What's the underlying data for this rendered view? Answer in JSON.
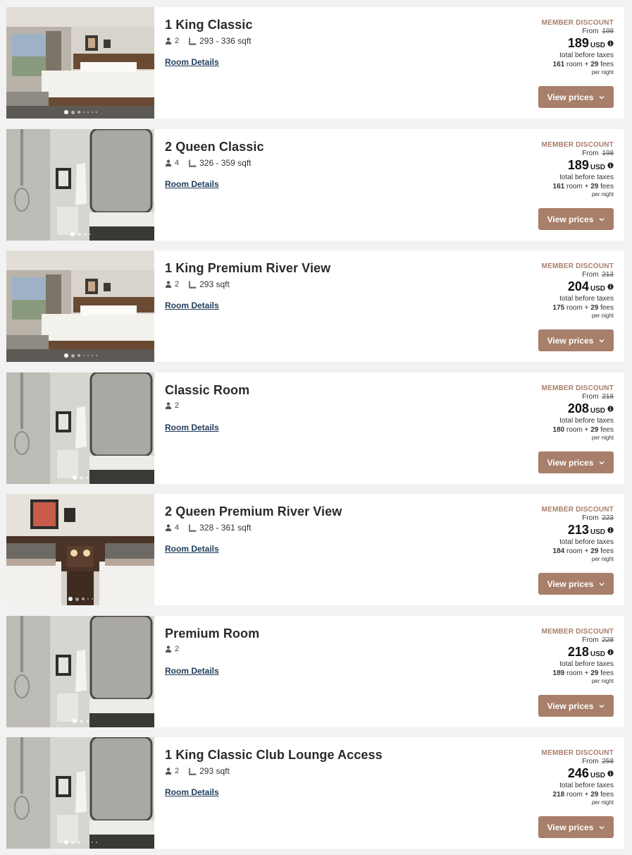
{
  "colors": {
    "accent": "#a87f6a",
    "link": "#1f3c5a",
    "card_bg": "#ffffff",
    "page_bg": "#f2f2f2"
  },
  "labels": {
    "discount": "MEMBER DISCOUNT",
    "from": "From",
    "currency": "USD",
    "before_taxes": "total before taxes",
    "room_word": "room +",
    "fees_word": "fees",
    "per_night": "per night",
    "details": "Room Details",
    "view_prices": "View prices"
  },
  "rooms": [
    {
      "title": "1 King Classic",
      "guests": "2",
      "area": "293 - 336 sqft",
      "old_price": "198",
      "price": "189",
      "room_fee": "161",
      "fees": "29",
      "photo": "bedroom-king",
      "dots": 7,
      "active_dot": 0
    },
    {
      "title": "2 Queen Classic",
      "guests": "4",
      "area": "326 - 359 sqft",
      "old_price": "198",
      "price": "189",
      "room_fee": "161",
      "fees": "29",
      "photo": "bathroom",
      "dots": 4,
      "active_dot": 0
    },
    {
      "title": "1 King Premium River View",
      "guests": "2",
      "area": "293 sqft",
      "old_price": "213",
      "price": "204",
      "room_fee": "175",
      "fees": "29",
      "photo": "bedroom-king",
      "dots": 7,
      "active_dot": 0
    },
    {
      "title": "Classic Room",
      "guests": "2",
      "area": "",
      "old_price": "218",
      "price": "208",
      "room_fee": "180",
      "fees": "29",
      "photo": "bathroom",
      "dots": 3,
      "active_dot": 0
    },
    {
      "title": "2 Queen Premium River View",
      "guests": "4",
      "area": "328 - 361 sqft",
      "old_price": "223",
      "price": "213",
      "room_fee": "184",
      "fees": "29",
      "photo": "bedroom-queen",
      "dots": 5,
      "active_dot": 0
    },
    {
      "title": "Premium Room",
      "guests": "2",
      "area": "",
      "old_price": "228",
      "price": "218",
      "room_fee": "189",
      "fees": "29",
      "photo": "bathroom",
      "dots": 3,
      "active_dot": 0
    },
    {
      "title": "1 King Classic Club Lounge Access",
      "guests": "2",
      "area": "293 sqft",
      "old_price": "258",
      "price": "246",
      "room_fee": "218",
      "fees": "29",
      "photo": "bathroom",
      "dots": 7,
      "active_dot": 0
    }
  ]
}
